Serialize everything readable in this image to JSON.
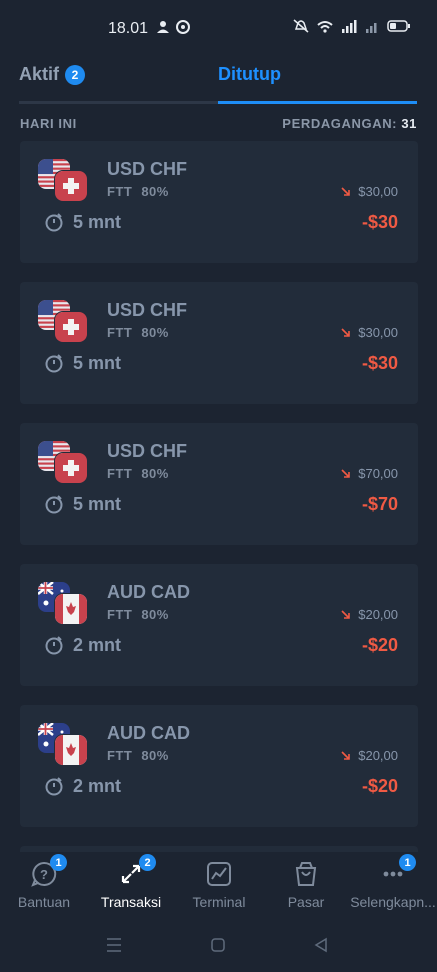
{
  "status_bar": {
    "time": "18.01"
  },
  "tabs": [
    {
      "label": "Aktif",
      "badge": "2"
    },
    {
      "label": "Ditutup"
    }
  ],
  "section": {
    "day_label": "HARI INI",
    "trades_label": "PERDAGANGAN:",
    "trades_count": "31"
  },
  "trades": [
    {
      "pair": "USD CHF",
      "type": "FTT",
      "percent": "80%",
      "duration": "5 mnt",
      "investment": "$30,00",
      "result": "-$30",
      "flags": [
        "us",
        "ch"
      ]
    },
    {
      "pair": "USD CHF",
      "type": "FTT",
      "percent": "80%",
      "duration": "5 mnt",
      "investment": "$30,00",
      "result": "-$30",
      "flags": [
        "us",
        "ch"
      ]
    },
    {
      "pair": "USD CHF",
      "type": "FTT",
      "percent": "80%",
      "duration": "5 mnt",
      "investment": "$70,00",
      "result": "-$70",
      "flags": [
        "us",
        "ch"
      ]
    },
    {
      "pair": "AUD CAD",
      "type": "FTT",
      "percent": "80%",
      "duration": "2 mnt",
      "investment": "$20,00",
      "result": "-$20",
      "flags": [
        "au",
        "ca"
      ]
    },
    {
      "pair": "AUD CAD",
      "type": "FTT",
      "percent": "80%",
      "duration": "2 mnt",
      "investment": "$20,00",
      "result": "-$20",
      "flags": [
        "au",
        "ca"
      ]
    }
  ],
  "bottom_nav": [
    {
      "label": "Bantuan",
      "badge": "1",
      "icon": "help-icon"
    },
    {
      "label": "Transaksi",
      "badge": "2",
      "icon": "transactions-icon",
      "active": true
    },
    {
      "label": "Terminal",
      "icon": "terminal-chart-icon"
    },
    {
      "label": "Pasar",
      "icon": "market-bag-icon"
    },
    {
      "label": "Selengkapn...",
      "badge": "1",
      "icon": "more-icon"
    }
  ],
  "colors": {
    "accent": "#1e8ef7",
    "loss": "#f05a44",
    "background": "#1c2431",
    "card": "#222c3a"
  }
}
